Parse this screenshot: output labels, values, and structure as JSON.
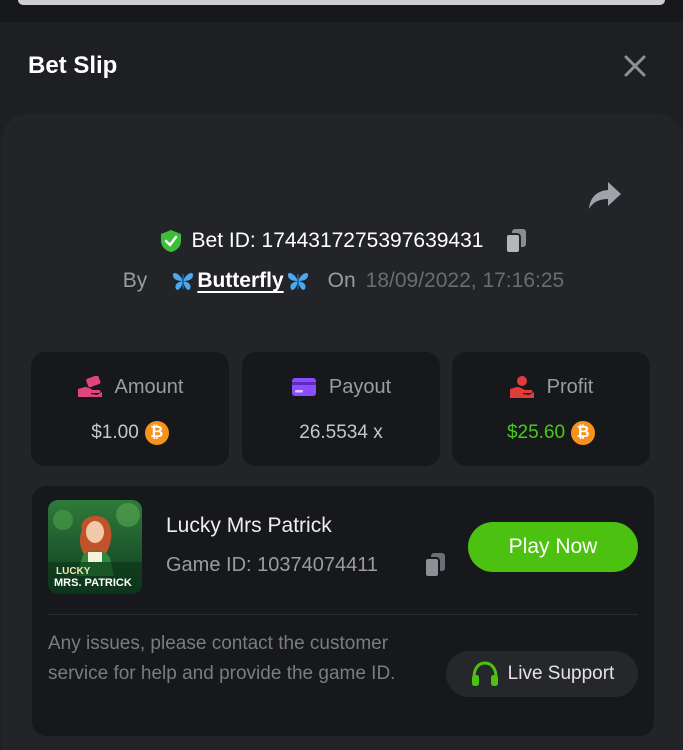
{
  "header": {
    "title": "Bet Slip"
  },
  "bet": {
    "id_label": "Bet ID: 1744317275397639431",
    "by_label": "By",
    "user": "Butterfly",
    "on_label": "On",
    "datetime": "18/09/2022, 17:16:25"
  },
  "stats": [
    {
      "label": "Amount",
      "value": "$1.00",
      "icon": "money-hand-icon",
      "currency": "bitcoin-icon"
    },
    {
      "label": "Payout",
      "value": "26.5534 x",
      "icon": "card-icon"
    },
    {
      "label": "Profit",
      "value": "$25.60",
      "icon": "profit-hand-icon",
      "currency": "bitcoin-icon"
    }
  ],
  "game": {
    "title": "Lucky Mrs Patrick",
    "id_label": "Game ID: 10374074411",
    "thumb_line1": "LUCKY",
    "thumb_line2": "MRS. PATRICK",
    "play_label": "Play Now"
  },
  "support": {
    "text": "Any issues, please contact the customer service for help and provide the game ID.",
    "button_label": "Live Support"
  },
  "colors": {
    "accent_green": "#4cc10f",
    "profit_green": "#4cc71a",
    "bitcoin": "#f7931a",
    "amount_icon": "#e0467c",
    "payout_icon": "#8a4dff",
    "profit_icon": "#e23b3b",
    "background": "#17181b"
  }
}
